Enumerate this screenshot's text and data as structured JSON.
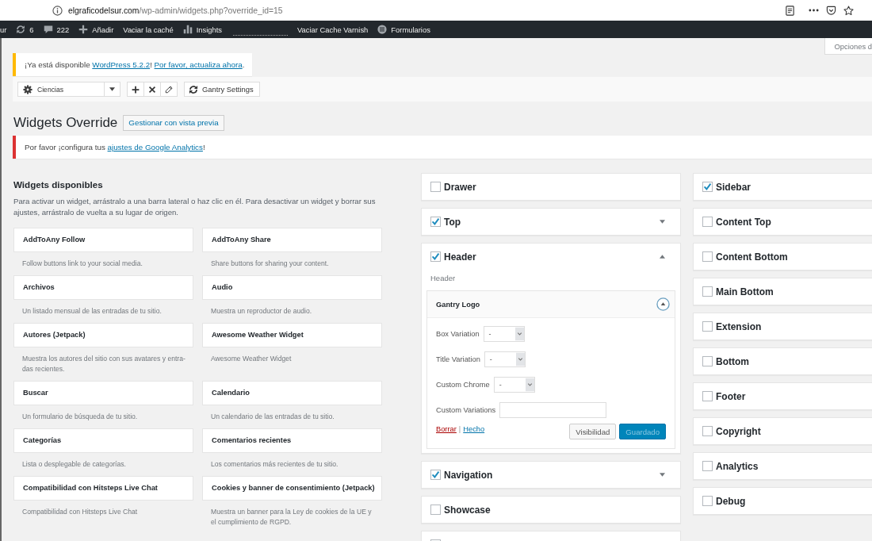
{
  "browser": {
    "url_domain": "elgraficodelsur.com",
    "url_path": "/wp-admin/widgets.php?override_id=15"
  },
  "admin_bar": [
    {
      "kind": "text",
      "label": "ur"
    },
    {
      "kind": "updates",
      "label": "6"
    },
    {
      "kind": "comments",
      "label": "222"
    },
    {
      "kind": "new",
      "label": "Añadir"
    },
    {
      "kind": "text",
      "label": "Vaciar la caché"
    },
    {
      "kind": "insights",
      "label": "Insights"
    },
    {
      "kind": "blank"
    },
    {
      "kind": "text",
      "label": "Vaciar Cache Varnish"
    },
    {
      "kind": "forms",
      "label": "Formularios"
    }
  ],
  "screen_options": "Opciones d",
  "update_notice": {
    "kind": "warning",
    "parts": [
      {
        "text": "¡Ya está disponible ",
        "link": false
      },
      {
        "text": "WordPress 5.2.2",
        "link": true
      },
      {
        "text": "! ",
        "link": false
      },
      {
        "text": "Por favor, actualiza ahora",
        "link": true
      },
      {
        "text": ".",
        "link": false
      }
    ]
  },
  "gantry_toolbar": {
    "outline": "Ciencias",
    "settings_button": "Gantry Settings"
  },
  "page_title": "Widgets Override",
  "preview_button": "Gestionar con vista previa",
  "analytics_notice": {
    "kind": "error",
    "parts": [
      {
        "text": "Por favor ¡configura tus ",
        "link": false
      },
      {
        "text": "ajustes de Google Analytics",
        "link": true
      },
      {
        "text": "!",
        "link": false
      }
    ]
  },
  "available_widgets": {
    "title": "Widgets disponibles",
    "description": "Para activar un widget, arrástralo a una barra lateral o haz clic en él. Para desactivar un widget y borrar sus ajustes, arrástralo de vuelta a su lugar de origen.",
    "widgets": [
      {
        "name": "AddToAny Follow",
        "description": "Follow buttons link to your social media."
      },
      {
        "name": "AddToAny Share",
        "description": "Share buttons for sharing your content."
      },
      {
        "name": "Archivos",
        "description": "Un listado mensual de las entradas de tu sitio."
      },
      {
        "name": "Audio",
        "description": "Muestra un reproductor de audio."
      },
      {
        "name": "Autores (Jetpack)",
        "description": "Muestra los autores del sitio con sus avatares y entra-das recientes."
      },
      {
        "name": "Awesome Weather Widget",
        "description": "Awesome Weather Widget"
      },
      {
        "name": "Buscar",
        "description": "Un formulario de búsqueda de tu sitio."
      },
      {
        "name": "Calendario",
        "description": "Un calendario de las entradas de tu sitio."
      },
      {
        "name": "Categorías",
        "description": "Lista o desplegable de categorías."
      },
      {
        "name": "Comentarios recientes",
        "description": "Los comentarios más recientes de tu sitio."
      },
      {
        "name": "Compatibilidad con Hitsteps Live Chat",
        "description": "Compatibilidad con Hitsteps Live Chat"
      },
      {
        "name": "Cookies y banner de consentimiento (Jetpack)",
        "description": "Muestra un banner para la Ley de cookies de la UE y el cumplimiento de RGPD."
      }
    ]
  },
  "sidebars_middle": [
    {
      "name": "Drawer",
      "checked": false
    },
    {
      "name": "Top",
      "checked": true,
      "expanded": false
    },
    {
      "name": "Header",
      "checked": true,
      "expanded": true,
      "description": "Header",
      "widgets": [
        {
          "title": "Gantry Logo",
          "expanded": true,
          "fields": [
            {
              "kind": "select",
              "label": "Box Variation",
              "value": "-"
            },
            {
              "kind": "select",
              "label": "Title Variation",
              "value": "-"
            },
            {
              "kind": "select",
              "label": "Custom Chrome",
              "value": "-"
            },
            {
              "kind": "text",
              "label": "Custom Variations"
            }
          ],
          "links": [
            {
              "kind": "delete",
              "label": "Borrar"
            },
            {
              "kind": "separator",
              "label": "|"
            },
            {
              "kind": "done",
              "label": "Hecho"
            }
          ],
          "buttons": [
            {
              "kind": "secondary",
              "label": "Visibilidad",
              "disabled": false
            },
            {
              "kind": "primary",
              "label": "Guardado",
              "disabled": true
            }
          ]
        }
      ]
    },
    {
      "name": "Navigation",
      "checked": true,
      "expanded": false
    },
    {
      "name": "Showcase",
      "checked": false
    },
    {
      "checked": false
    }
  ],
  "sidebars_right": [
    {
      "name": "Sidebar",
      "checked": true
    },
    {
      "name": "Content Top",
      "checked": false
    },
    {
      "name": "Content Bottom",
      "checked": false
    },
    {
      "name": "Main Bottom",
      "checked": false
    },
    {
      "name": "Extension",
      "checked": false
    },
    {
      "name": "Bottom",
      "checked": false
    },
    {
      "name": "Footer",
      "checked": false
    },
    {
      "name": "Copyright",
      "checked": false
    },
    {
      "name": "Analytics",
      "checked": false
    },
    {
      "name": "Debug",
      "checked": false
    }
  ]
}
